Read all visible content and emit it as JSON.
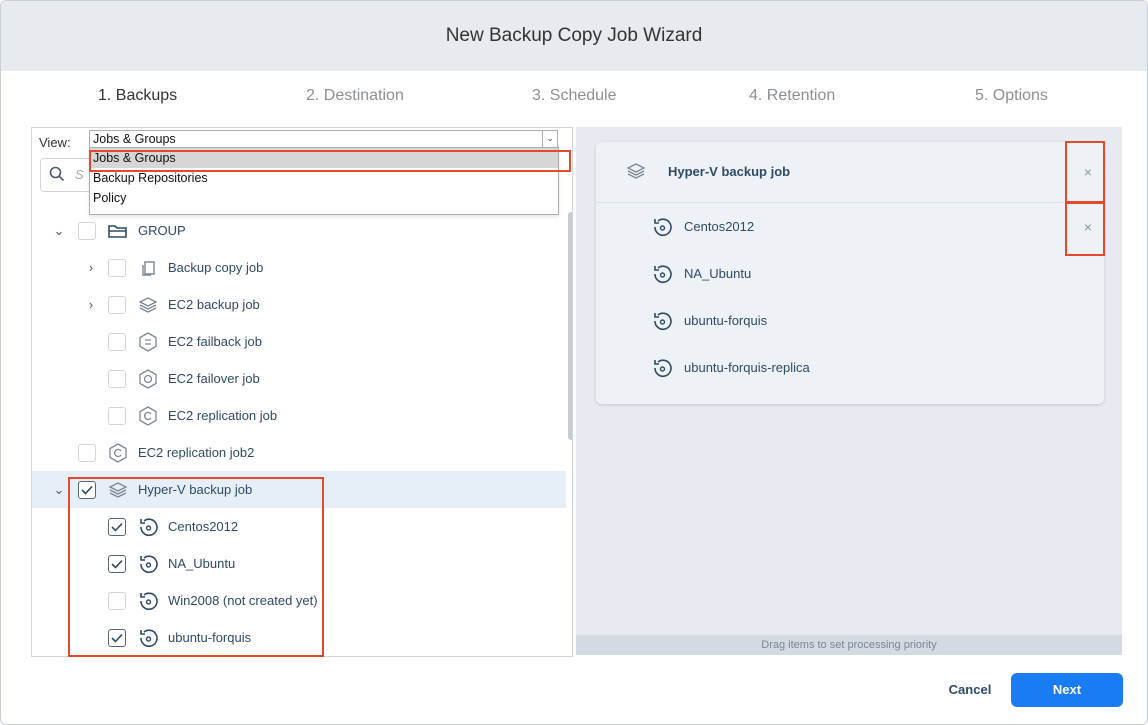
{
  "window": {
    "title": "New Backup Copy Job Wizard"
  },
  "steps": [
    "1. Backups",
    "2. Destination",
    "3. Schedule",
    "4. Retention",
    "5. Options"
  ],
  "view": {
    "label": "View:",
    "selected": "Jobs & Groups",
    "options": [
      "Jobs & Groups",
      "Backup Repositories",
      "Policy"
    ]
  },
  "search": {
    "placeholder": "S"
  },
  "tree": [
    {
      "label": "GROUP",
      "icon": "folder-icon",
      "checked": false,
      "expanded": true
    },
    {
      "label": "Backup copy job",
      "icon": "copy-job-icon",
      "checked": false
    },
    {
      "label": "EC2 backup job",
      "icon": "layers-icon",
      "checked": false
    },
    {
      "label": "EC2 failback job",
      "icon": "failback-icon",
      "checked": false
    },
    {
      "label": "EC2 failover job",
      "icon": "failover-icon",
      "checked": false
    },
    {
      "label": "EC2 replication job",
      "icon": "replication-icon",
      "checked": false
    },
    {
      "label": "EC2 replication job2",
      "icon": "replication-icon",
      "checked": false
    },
    {
      "label": "Hyper-V backup job",
      "icon": "layers-icon",
      "checked": true,
      "expanded": true
    },
    {
      "label": "Centos2012",
      "icon": "vm-restore-icon",
      "checked": true
    },
    {
      "label": "NA_Ubuntu",
      "icon": "vm-restore-icon",
      "checked": true
    },
    {
      "label": "Win2008 (not created yet)",
      "icon": "vm-restore-icon",
      "checked": false
    },
    {
      "label": "ubuntu-forquis",
      "icon": "vm-restore-icon",
      "checked": true
    }
  ],
  "selected_card": {
    "title": "Hyper-V backup job",
    "items": [
      "Centos2012",
      "NA_Ubuntu",
      "ubuntu-forquis",
      "ubuntu-forquis-replica"
    ]
  },
  "drag_hint": "Drag items to set processing priority",
  "buttons": {
    "cancel": "Cancel",
    "next": "Next"
  },
  "colors": {
    "accent": "#1a7cf5",
    "highlight_box": "#e4492e"
  }
}
